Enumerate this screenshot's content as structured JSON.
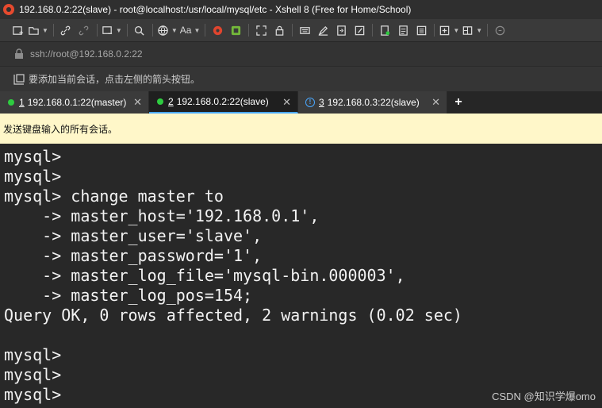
{
  "window": {
    "title": "192.168.0.2:22(slave) - root@localhost:/usr/local/mysql/etc - Xshell 8 (Free for Home/School)"
  },
  "toolbar": {
    "buttons": [
      "new-session-icon",
      "open-folder-icon",
      "link-icon",
      "unlink-icon",
      "new-tab-icon",
      "search-icon",
      "globe-icon",
      "font-size-icon",
      "xftp-icon",
      "xmanager-icon",
      "fullscreen-icon",
      "lock-icon",
      "keyboard-icon",
      "highlight-icon",
      "script-icon",
      "compose-icon",
      "send-icon",
      "log-icon",
      "list-icon",
      "add-layout-icon",
      "split-icon",
      "chat-icon"
    ],
    "font_label": "Aa"
  },
  "address": {
    "value": "ssh://root@192.168.0.2:22"
  },
  "hint": {
    "text": "要添加当前会话，点击左侧的箭头按钮。"
  },
  "tabs": [
    {
      "num": "1",
      "label": "192.168.0.1:22(master)",
      "status": "connected"
    },
    {
      "num": "2",
      "label": "192.168.0.2:22(slave)",
      "status": "connected",
      "active": true
    },
    {
      "num": "3",
      "label": "192.168.0.3:22(slave)",
      "status": "warning"
    }
  ],
  "tab_close": "✕",
  "tab_add": "+",
  "broadcast": {
    "text": "发送键盘输入的所有会话。"
  },
  "terminal": {
    "lines": [
      "mysql>",
      "mysql>",
      "mysql> change master to",
      "    -> master_host='192.168.0.1',",
      "    -> master_user='slave',",
      "    -> master_password='1',",
      "    -> master_log_file='mysql-bin.000003',",
      "    -> master_log_pos=154;",
      "Query OK, 0 rows affected, 2 warnings (0.02 sec)",
      "",
      "mysql>",
      "mysql>",
      "mysql>"
    ]
  },
  "watermark": "CSDN @知识学爆omo",
  "colors": {
    "accent": "#4aa8ff",
    "connected": "#2ecc40",
    "banner": "#fff7c9",
    "terminal_bg": "#282828"
  }
}
